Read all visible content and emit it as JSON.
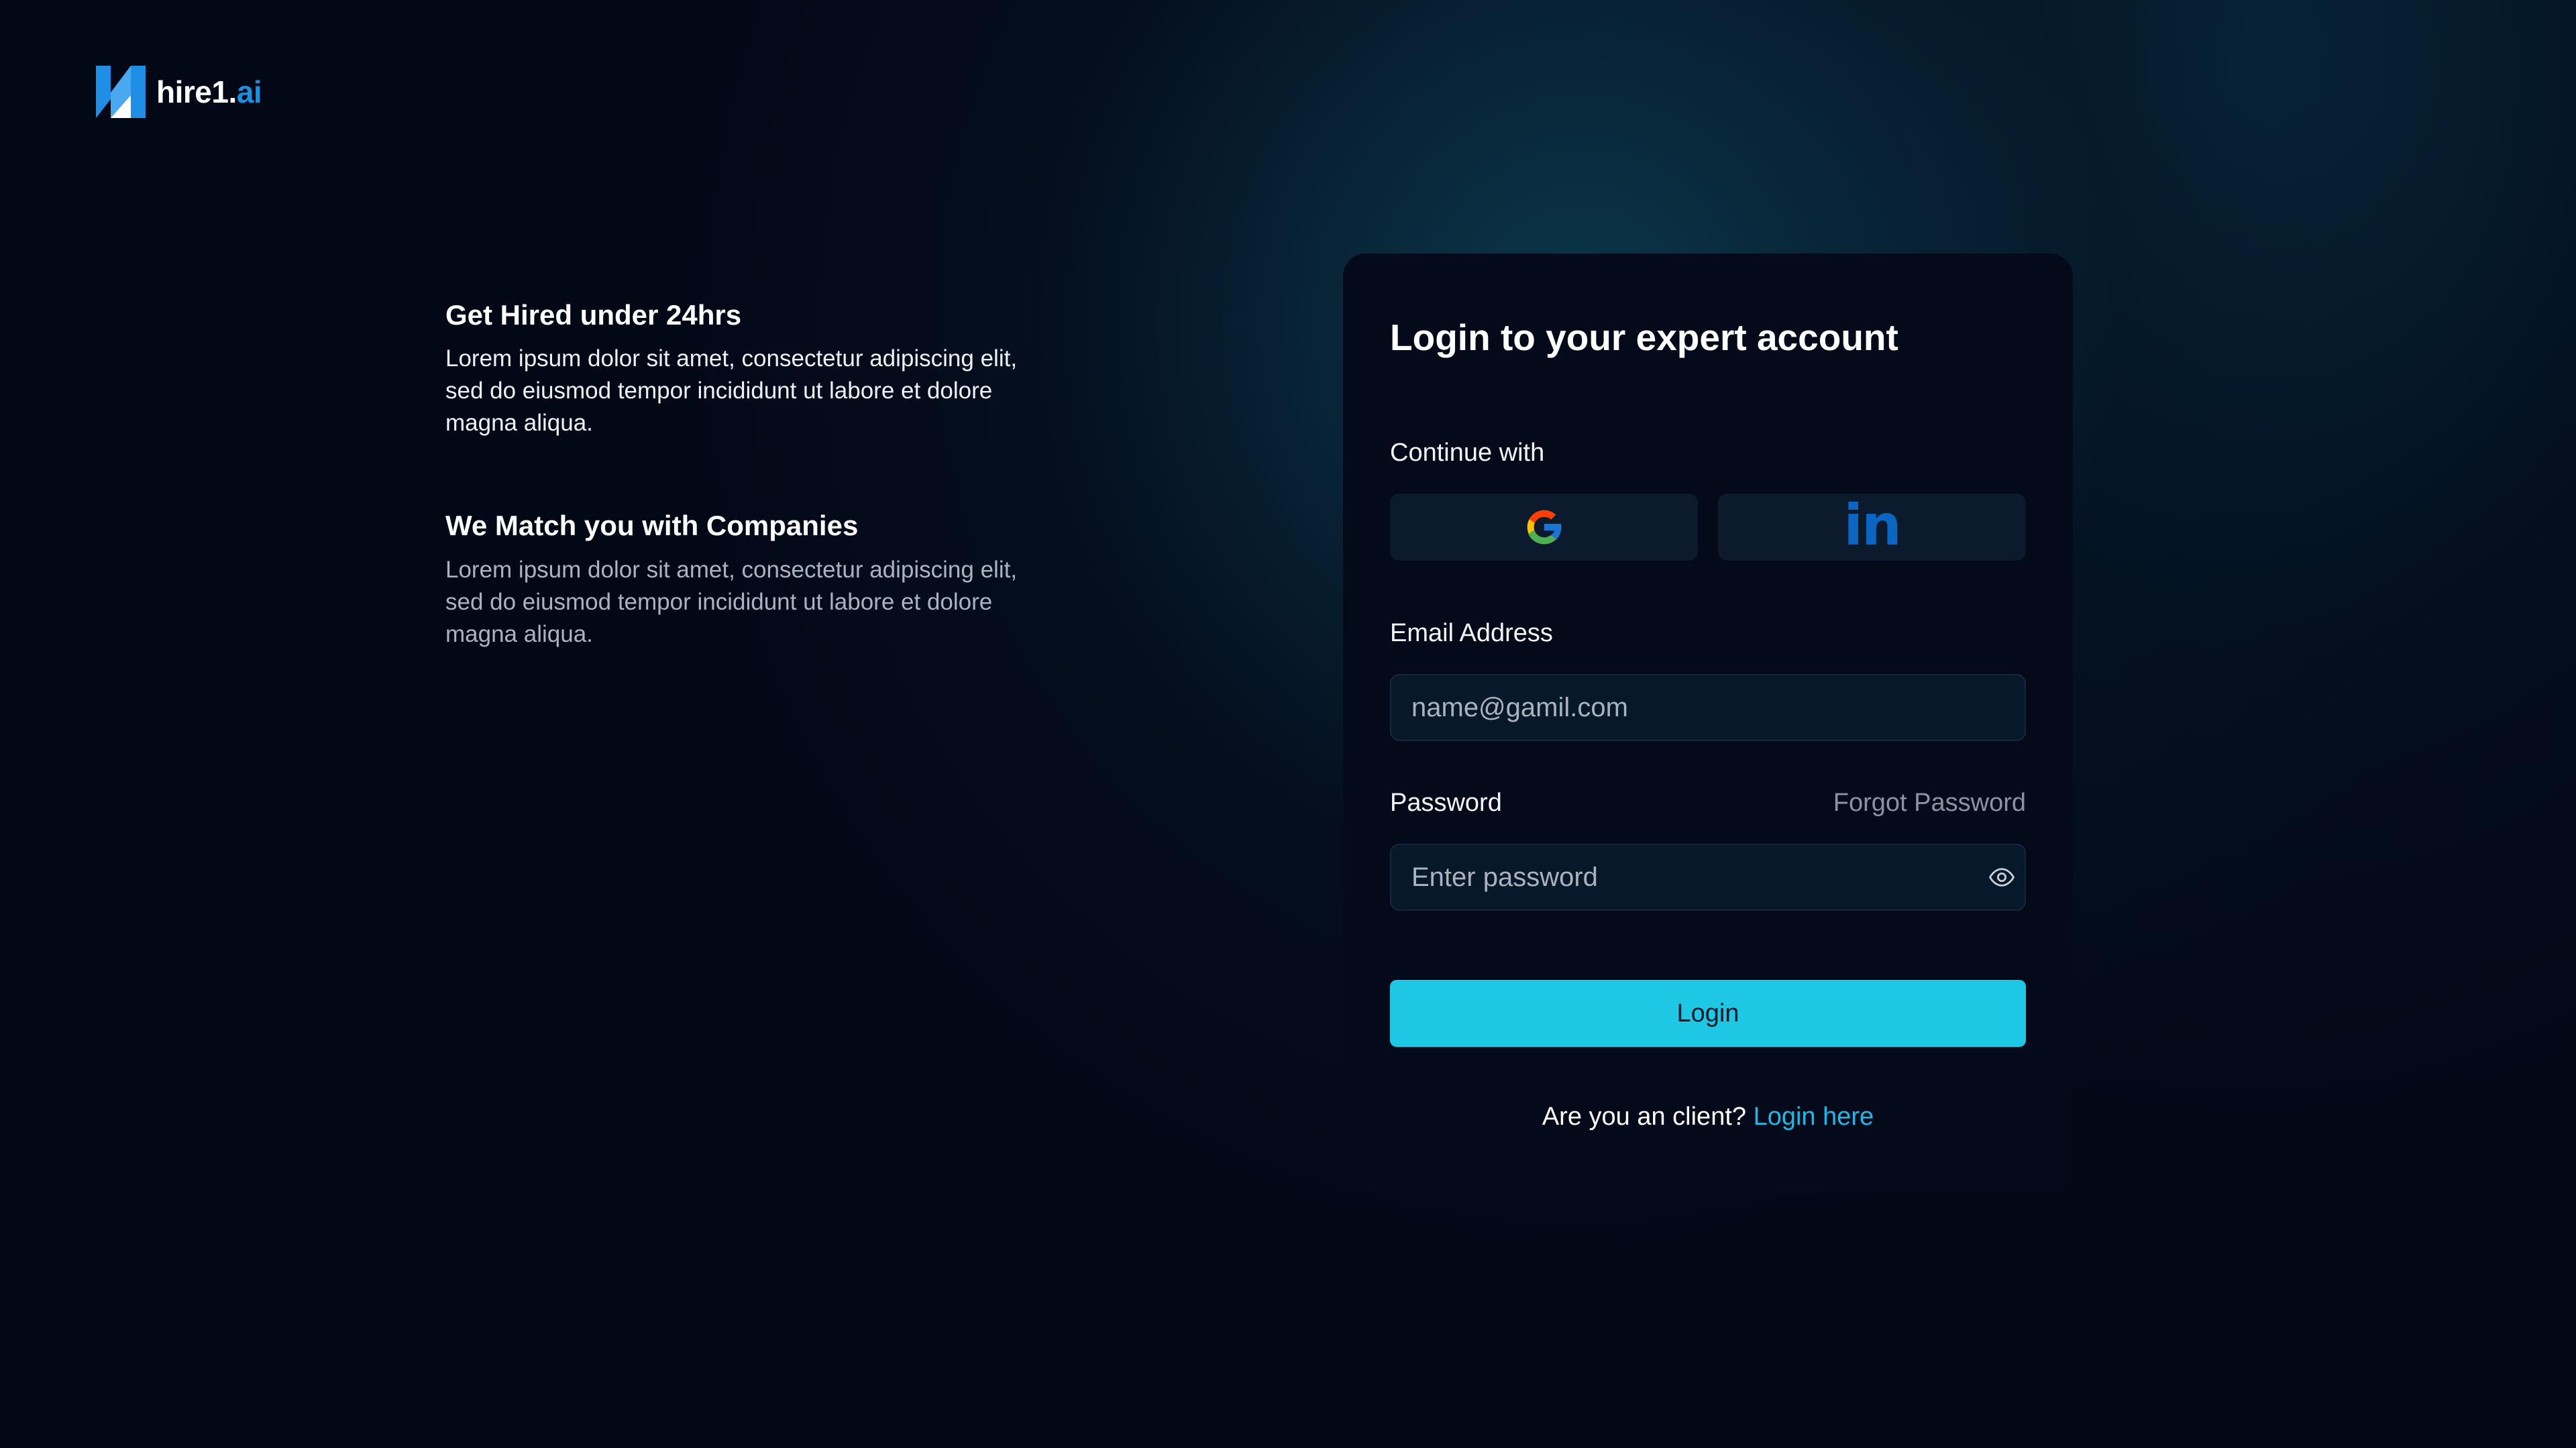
{
  "brand": {
    "name_main": "hire1.",
    "name_accent": "ai",
    "icon": "hire1-logo-icon",
    "accent_color": "#1b8fe0"
  },
  "features": [
    {
      "title": "Get Hired under 24hrs",
      "description": "Lorem ipsum dolor sit amet, consectetur adipiscing elit, sed do eiusmod tempor incididunt ut labore et dolore magna aliqua."
    },
    {
      "title": "We Match you with Companies",
      "description": "Lorem ipsum dolor sit amet, consectetur adipiscing elit, sed do eiusmod tempor incididunt ut labore et dolore magna aliqua."
    }
  ],
  "login": {
    "title": "Login to your expert account",
    "continue_label": "Continue with",
    "social": [
      {
        "provider": "google",
        "icon": "google-icon"
      },
      {
        "provider": "linkedin",
        "icon": "linkedin-icon",
        "glyph": "in"
      }
    ],
    "email": {
      "label": "Email Address",
      "placeholder": "name@gamil.com",
      "value": ""
    },
    "password": {
      "label": "Password",
      "placeholder": "Enter password",
      "value": "",
      "toggle_icon": "eye-icon"
    },
    "forgot_label": "Forgot Password",
    "submit_label": "Login",
    "client_prompt": "Are you an client?",
    "client_link": "Login here"
  },
  "colors": {
    "primary_button": "#1ec7e4",
    "link": "#22b8e6",
    "linkedin": "#0a66c2",
    "background": "#030817",
    "card": "#040a1a"
  }
}
